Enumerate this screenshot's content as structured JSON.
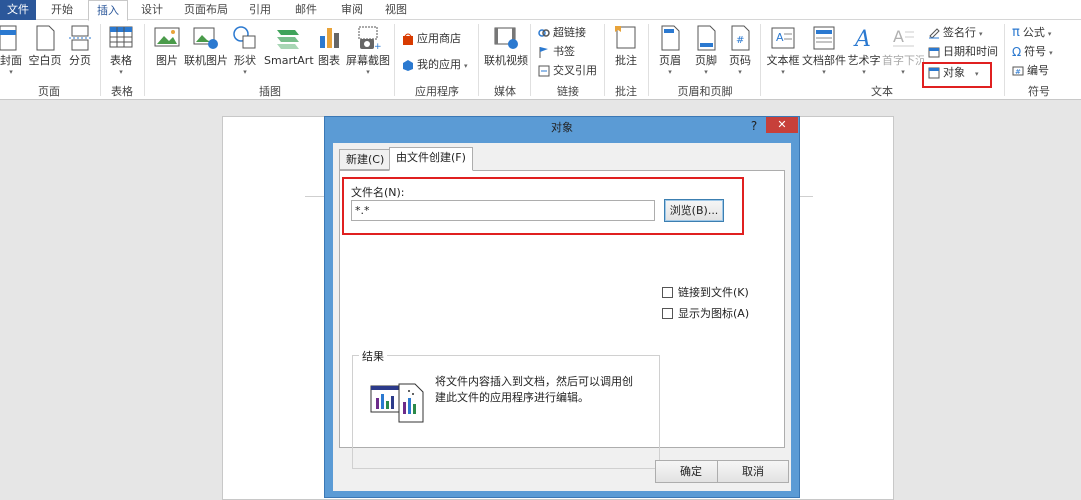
{
  "menu_tabs": [
    "文件",
    "开始",
    "插入",
    "设计",
    "页面布局",
    "引用",
    "邮件",
    "审阅",
    "视图"
  ],
  "ribbon": {
    "pages_group": {
      "buttons": [
        "封面",
        "空白页",
        "分页"
      ],
      "label": "页面"
    },
    "table_group": {
      "button": "表格",
      "label": "表格"
    },
    "illustrations_group": {
      "buttons": [
        "图片",
        "联机图片",
        "形状",
        "SmartArt",
        "图表",
        "屏幕截图"
      ],
      "label": "插图"
    },
    "apps_group": {
      "buttons": [
        "应用商店",
        "我的应用"
      ],
      "label": "应用程序"
    },
    "media_group": {
      "button": "联机视频",
      "label": "媒体"
    },
    "links_group": {
      "buttons": [
        "超链接",
        "书签",
        "交叉引用"
      ],
      "label": "链接"
    },
    "comments_group": {
      "button": "批注",
      "label": "批注"
    },
    "header_footer_group": {
      "buttons": [
        "页眉",
        "页脚",
        "页码"
      ],
      "label": "页眉和页脚"
    },
    "text_group": {
      "buttons": [
        "文本框",
        "文档部件",
        "艺术字",
        "首字下沉"
      ],
      "small_buttons": [
        "签名行",
        "日期和时间",
        "对象"
      ],
      "label": "文本"
    },
    "symbols_group": {
      "buttons": [
        "公式",
        "符号",
        "编号"
      ],
      "label": "符号"
    }
  },
  "dialog": {
    "title": "对象",
    "help": "?",
    "close": "✕",
    "tabs": [
      "新建(C)",
      "由文件创建(F)"
    ],
    "file_name_label": "文件名(N):",
    "file_name_value": "*.*",
    "browse_button": "浏览(B)...",
    "link_to_file": "链接到文件(K)",
    "display_as_icon": "显示为图标(A)",
    "result_label": "结果",
    "result_text": "将文件内容插入到文档，然后可以调用创建此文件的应用程序进行编辑。",
    "ok_button": "确定",
    "cancel_button": "取消"
  },
  "colors": {
    "file_tab": "#2b579a",
    "dialog_frame": "#5b9bd5",
    "close_button": "#c7403a",
    "highlight": "#e02020"
  }
}
